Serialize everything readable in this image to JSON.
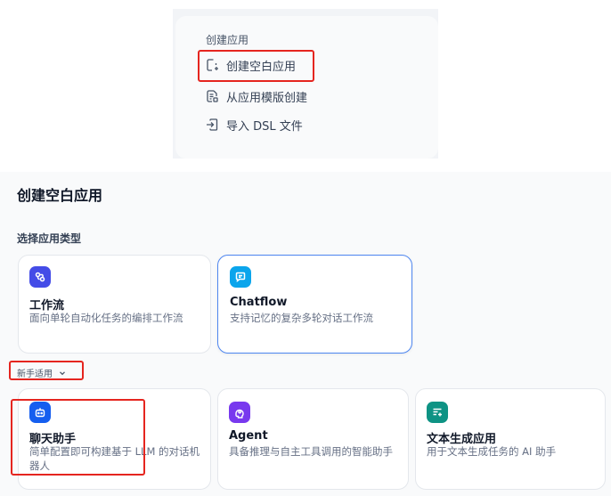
{
  "menu": {
    "heading": "创建应用",
    "items": [
      {
        "label": "创建空白应用",
        "icon": "blank-app-icon"
      },
      {
        "label": "从应用模版创建",
        "icon": "template-icon"
      },
      {
        "label": "导入 DSL 文件",
        "icon": "import-icon"
      }
    ]
  },
  "dialog": {
    "title": "创建空白应用",
    "section_label": "选择应用类型",
    "app_types": [
      {
        "title": "工作流",
        "desc": "面向单轮自动化任务的编排工作流",
        "icon": "workflow-icon",
        "color": "#444ce7",
        "selected": false
      },
      {
        "title": "Chatflow",
        "desc": "支持记忆的复杂多轮对话工作流",
        "icon": "chatflow-icon",
        "color": "#0ba5ec",
        "selected": true
      }
    ],
    "beginner_toggle": "新手适用",
    "beginner_types": [
      {
        "title": "聊天助手",
        "desc": "简单配置即可构建基于 LLM 的对话机器人",
        "icon": "chatbot-icon",
        "color": "#155eef"
      },
      {
        "title": "Agent",
        "desc": "具备推理与自主工具调用的智能助手",
        "icon": "agent-icon",
        "color": "#7839ee"
      },
      {
        "title": "文本生成应用",
        "desc": "用于文本生成任务的 AI 助手",
        "icon": "text-generation-icon",
        "color": "#0e9384"
      }
    ]
  },
  "colors": {
    "highlight": "#e5251f",
    "selected_border": "#4e86f0"
  }
}
